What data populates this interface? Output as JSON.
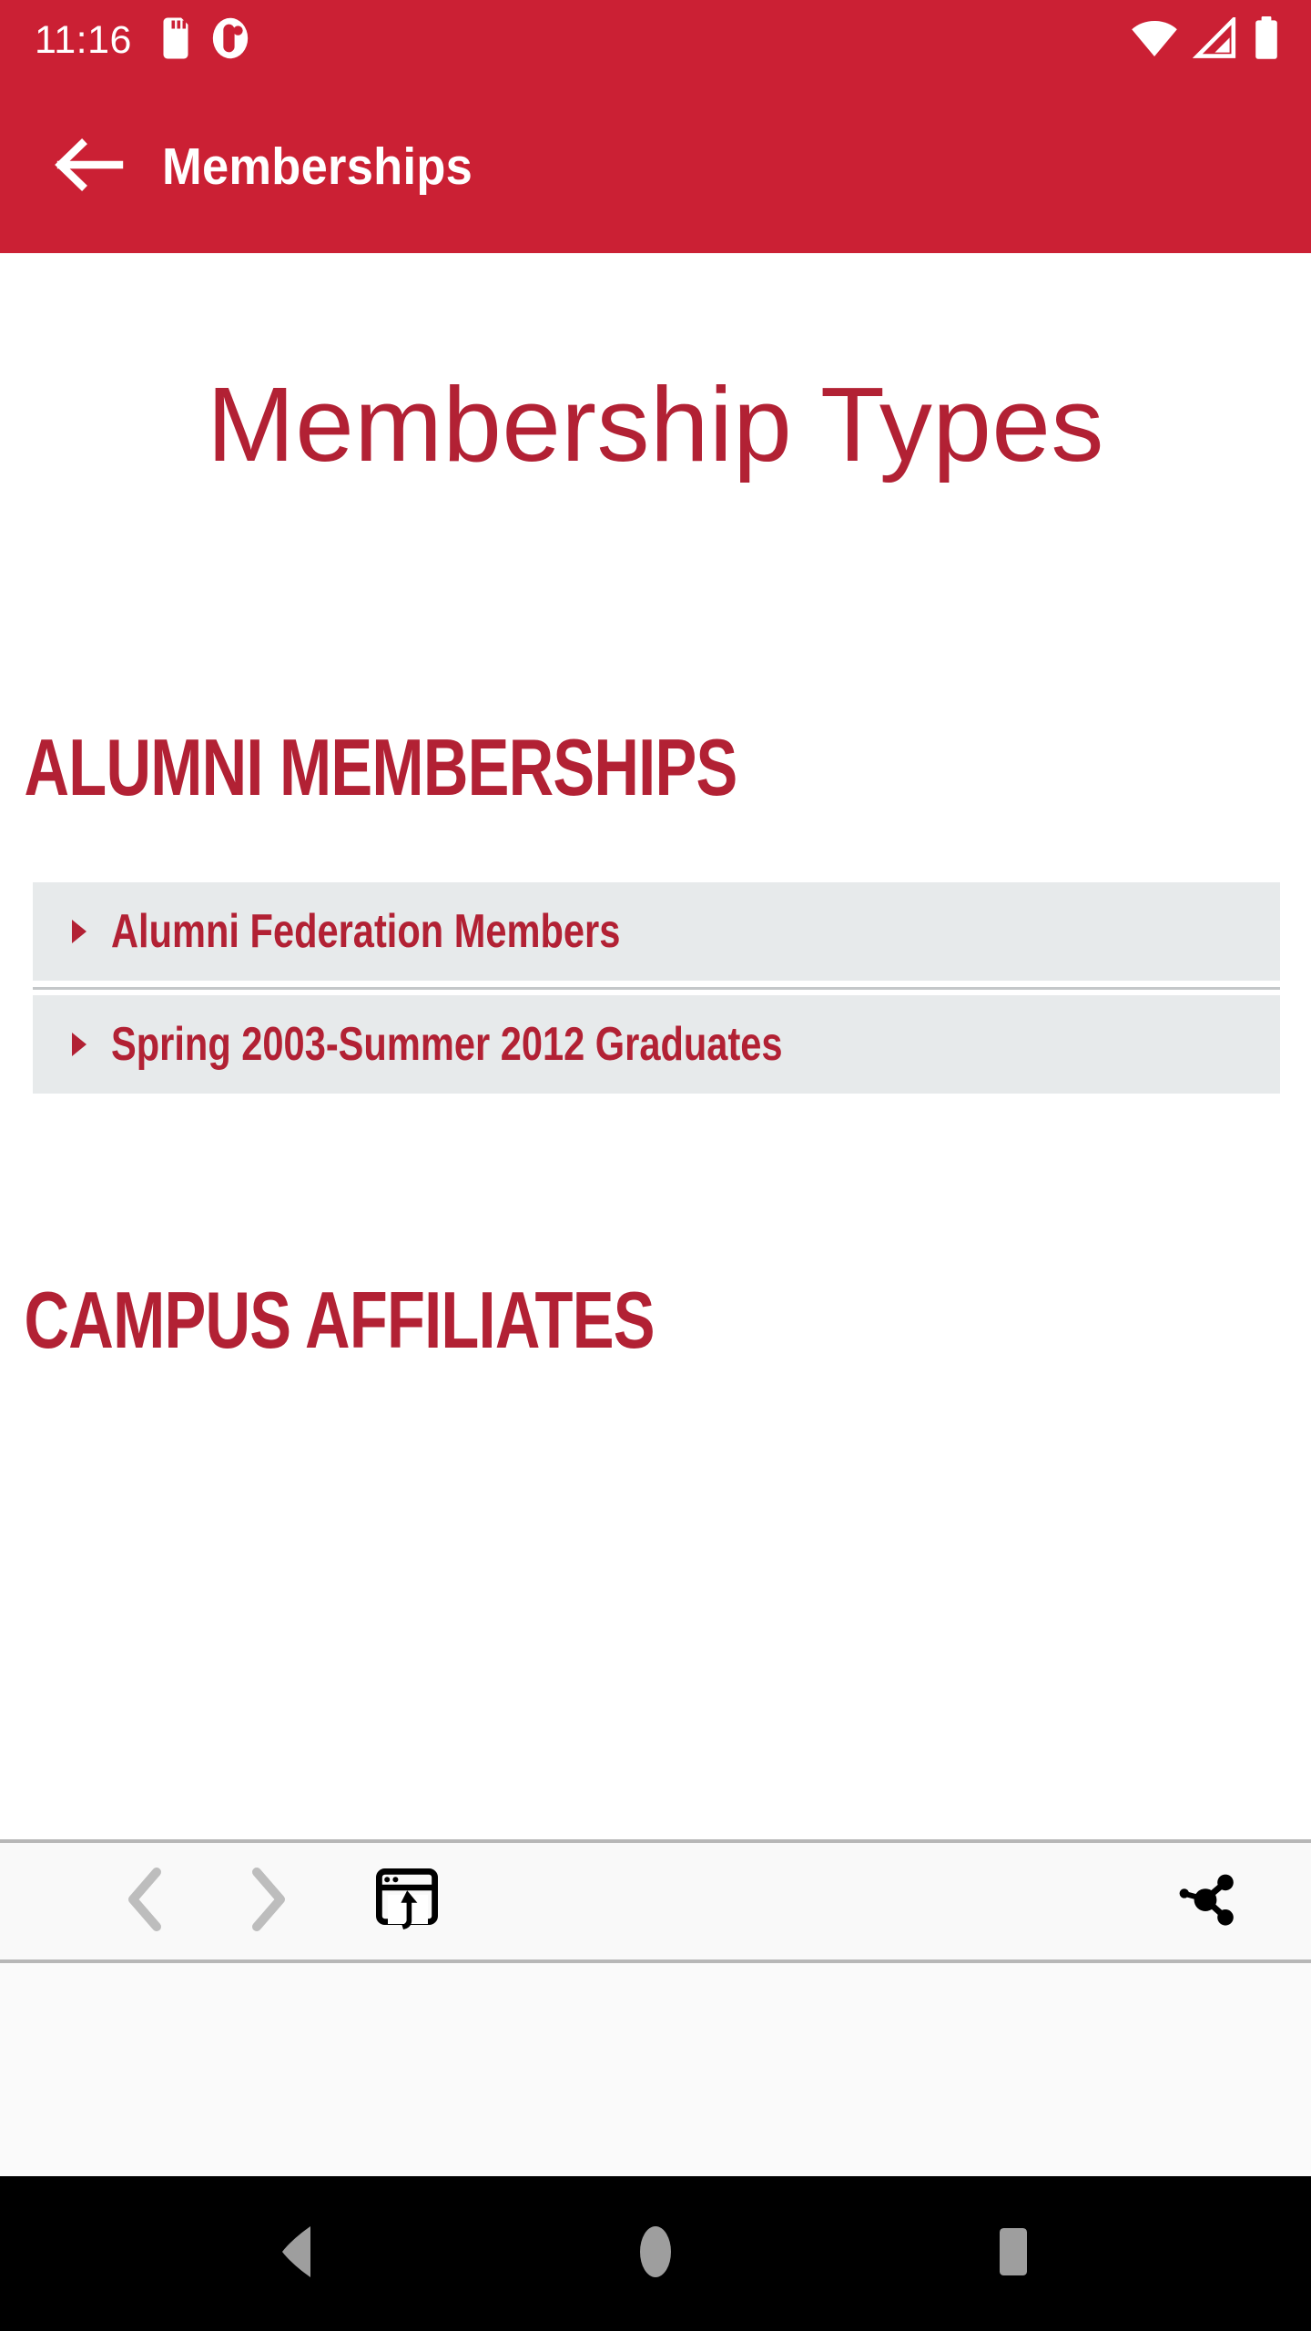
{
  "status_bar": {
    "time": "11:16",
    "icons_left": [
      "sd-card-icon",
      "app-notification-icon"
    ],
    "icons_right": [
      "wifi-icon",
      "cell-signal-icon",
      "battery-icon"
    ],
    "background_color": "#CB2034",
    "foreground_color": "#FFFFFF"
  },
  "app_bar": {
    "back_icon": "arrow-back-icon",
    "title": "Memberships",
    "background_color": "#CB2034",
    "text_color": "#FFFFFF"
  },
  "web_page": {
    "page_title": "Membership Types",
    "accent_color": "#B22134",
    "list_background_color": "#E7EAEB",
    "sections": [
      {
        "heading": "ALUMNI MEMBERSHIPS",
        "items": [
          {
            "label": "Alumni Federation Members",
            "bullet": "triangle-right-icon"
          },
          {
            "label": "Spring 2003-Summer 2012 Graduates",
            "bullet": "triangle-right-icon"
          }
        ]
      },
      {
        "heading": "CAMPUS AFFILIATES",
        "items": []
      }
    ]
  },
  "zoom_control": {
    "zoom_out_icon": "zoom-out-magnifier-icon",
    "zoom_in_icon": "zoom-in-magnifier-icon",
    "zoom_out_enabled": false,
    "zoom_in_enabled": true
  },
  "browser_toolbar": {
    "background_color": "#F9F9F9",
    "buttons": [
      {
        "name": "back",
        "icon": "chevron-left-icon",
        "enabled": false
      },
      {
        "name": "forward",
        "icon": "chevron-right-icon",
        "enabled": false
      },
      {
        "name": "open-in-browser",
        "icon": "open-in-browser-icon",
        "enabled": true
      },
      {
        "name": "share",
        "icon": "share-icon",
        "enabled": true
      }
    ]
  },
  "nav_bar": {
    "background_color": "#000000",
    "buttons": [
      {
        "name": "back",
        "icon": "nav-back-triangle-icon"
      },
      {
        "name": "home",
        "icon": "nav-home-circle-icon"
      },
      {
        "name": "recents",
        "icon": "nav-recents-square-icon"
      }
    ]
  }
}
